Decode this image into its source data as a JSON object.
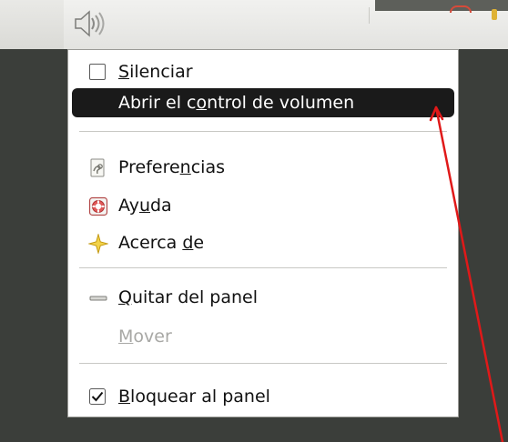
{
  "panel": {
    "volume_icon": "speaker-icon"
  },
  "menu": {
    "items": [
      {
        "label": "Silenciar",
        "underline_index": 0,
        "type": "checkbox",
        "checked": false,
        "icon": "checkbox-unchecked-icon"
      },
      {
        "label": "Abrir el control de volumen",
        "underline_index": 10,
        "type": "action",
        "highlighted": true,
        "icon": ""
      },
      {
        "label": "Preferencias",
        "underline_index": 7,
        "type": "action",
        "icon": "preferences-icon"
      },
      {
        "label": "Ayuda",
        "underline_index": 2,
        "type": "action",
        "icon": "help-icon"
      },
      {
        "label": "Acerca de",
        "underline_index": 7,
        "type": "action",
        "icon": "about-star-icon"
      },
      {
        "label": "Quitar del panel",
        "underline_index": 0,
        "type": "action",
        "icon": "remove-icon"
      },
      {
        "label": "Mover",
        "underline_index": 0,
        "type": "action",
        "disabled": true,
        "icon": ""
      },
      {
        "label": "Bloquear al panel",
        "underline_index": 0,
        "type": "checkbox",
        "checked": true,
        "icon": "checkbox-checked-icon"
      }
    ]
  },
  "colors": {
    "highlight_bg": "#1a1a1a",
    "highlight_text": "#ffffff",
    "annotation_arrow": "#e01919",
    "disabled_text": "#a8a8a5"
  }
}
